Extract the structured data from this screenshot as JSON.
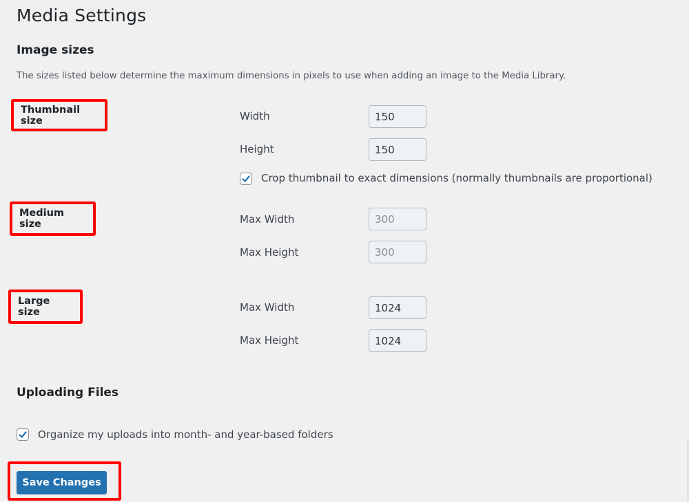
{
  "page": {
    "title": "Media Settings"
  },
  "image_sizes": {
    "heading": "Image sizes",
    "description": "The sizes listed below determine the maximum dimensions in pixels to use when adding an image to the Media Library.",
    "thumbnail": {
      "label": "Thumbnail size",
      "width_label": "Width",
      "width_value": "150",
      "height_label": "Height",
      "height_value": "150",
      "crop_label": "Crop thumbnail to exact dimensions (normally thumbnails are proportional)",
      "crop_checked": true
    },
    "medium": {
      "label": "Medium size",
      "max_width_label": "Max Width",
      "max_width_value": "300",
      "max_height_label": "Max Height",
      "max_height_value": "300"
    },
    "large": {
      "label": "Large size",
      "max_width_label": "Max Width",
      "max_width_value": "1024",
      "max_height_label": "Max Height",
      "max_height_value": "1024"
    }
  },
  "uploading": {
    "heading": "Uploading Files",
    "organize_label": "Organize my uploads into month- and year-based folders",
    "organize_checked": true
  },
  "actions": {
    "save_label": "Save Changes"
  },
  "colors": {
    "primary_button": "#2271b1",
    "highlight": "#ff0000",
    "checkmark": "#2271b1"
  }
}
